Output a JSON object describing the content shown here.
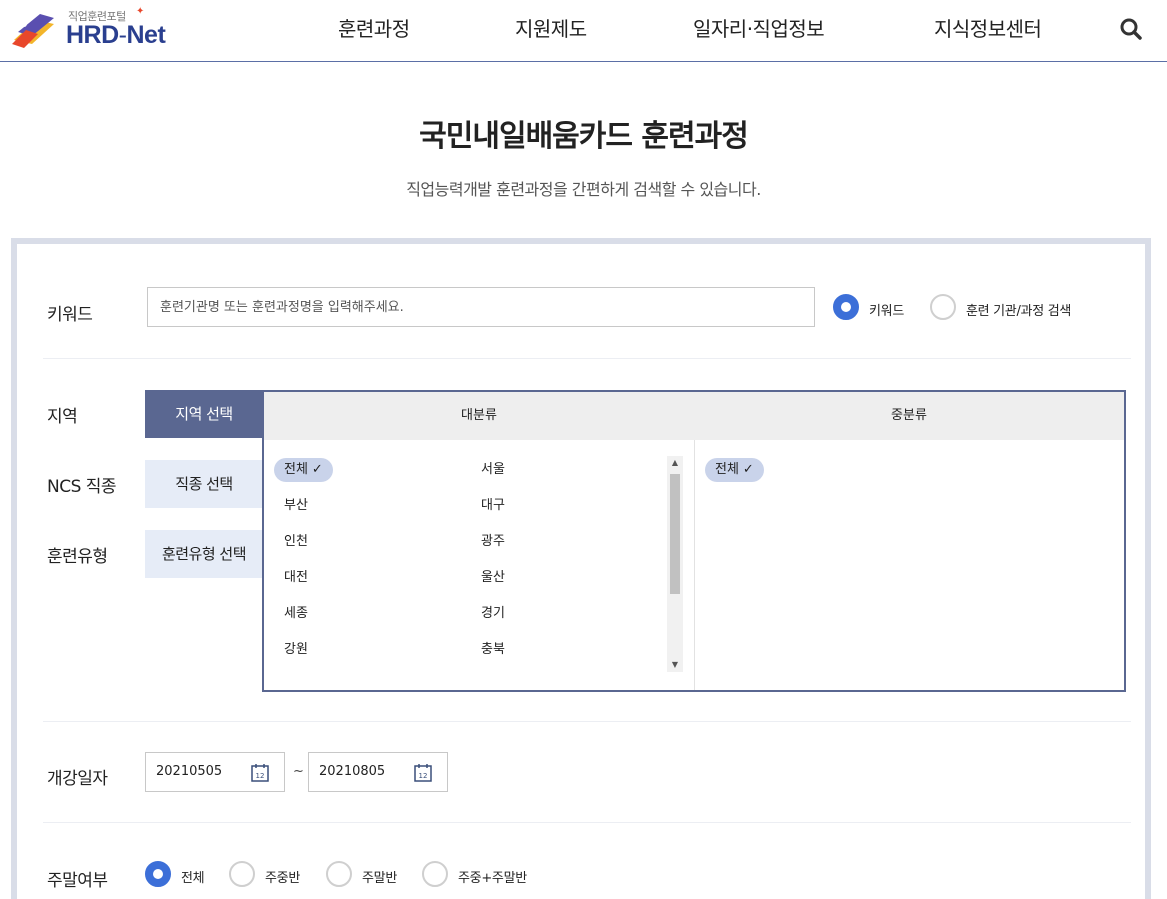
{
  "header": {
    "logo_sub": "직업훈련포털",
    "logo_main": "HRD",
    "logo_dash": "-",
    "logo_net": "Net",
    "nav": [
      "훈련과정",
      "지원제도",
      "일자리·직업정보",
      "지식정보센터"
    ],
    "search_icon": "search-icon"
  },
  "page": {
    "title": "국민내일배움카드 훈련과정",
    "subtitle": "직업능력개발 훈련과정을 간편하게 검색할 수 있습니다."
  },
  "keyword": {
    "label": "키워드",
    "placeholder": "훈련기관명 또는 훈련과정명을 입력해주세요.",
    "options": [
      {
        "label": "키워드",
        "selected": true
      },
      {
        "label": "훈련 기관/과정 검색",
        "selected": false
      }
    ]
  },
  "filters": {
    "region_label": "지역",
    "ncs_label": "NCS 직종",
    "type_label": "훈련유형",
    "region_btn": "지역 선택",
    "ncs_btn": "직종 선택",
    "type_btn": "훈련유형 선택"
  },
  "categories": {
    "major_header": "대분류",
    "minor_header": "중분류",
    "major_items": [
      "전체",
      "서울",
      "부산",
      "대구",
      "인천",
      "광주",
      "대전",
      "울산",
      "세종",
      "경기",
      "강원",
      "충북"
    ],
    "major_selected": "전체",
    "minor_items": [
      "전체"
    ],
    "minor_selected": "전체",
    "check_mark": "✓"
  },
  "dates": {
    "label": "개강일자",
    "start": "20210505",
    "end": "20210805",
    "separator": "~",
    "calendar_day": "12",
    "calendar_icon": "calendar-icon"
  },
  "weekend": {
    "label": "주말여부",
    "options": [
      {
        "label": "전체",
        "selected": true
      },
      {
        "label": "주중반",
        "selected": false
      },
      {
        "label": "주말반",
        "selected": false
      },
      {
        "label": "주중+주말반",
        "selected": false
      }
    ]
  },
  "colors": {
    "accent": "#3c6fd8",
    "tab_active": "#5a6791",
    "tab_inactive": "#e6ecf7",
    "chip": "#c9d3ea",
    "brand": "#2a3f8f"
  }
}
